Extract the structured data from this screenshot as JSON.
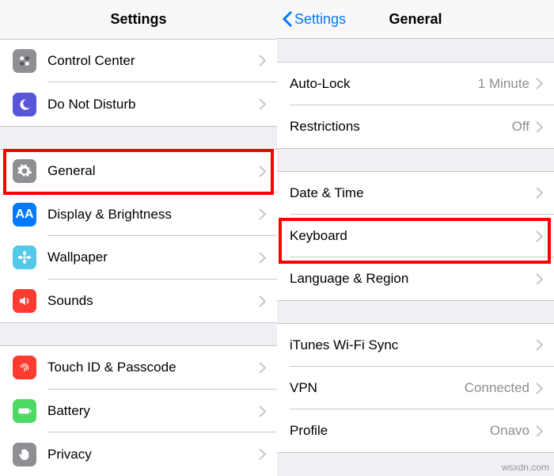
{
  "watermark": "wsxdn.com",
  "left": {
    "header_title": "Settings",
    "rows": {
      "control_center": "Control Center",
      "dnd": "Do Not Disturb",
      "general": "General",
      "display": "Display & Brightness",
      "wallpaper": "Wallpaper",
      "sounds": "Sounds",
      "touchid": "Touch ID & Passcode",
      "battery": "Battery",
      "privacy": "Privacy"
    }
  },
  "right": {
    "back_label": "Settings",
    "header_title": "General",
    "rows": {
      "autolock_label": "Auto-Lock",
      "autolock_value": "1 Minute",
      "restrictions_label": "Restrictions",
      "restrictions_value": "Off",
      "datetime": "Date & Time",
      "keyboard": "Keyboard",
      "language": "Language & Region",
      "itunes": "iTunes Wi-Fi Sync",
      "vpn_label": "VPN",
      "vpn_value": "Connected",
      "profile_label": "Profile",
      "profile_value": "Onavo"
    }
  }
}
